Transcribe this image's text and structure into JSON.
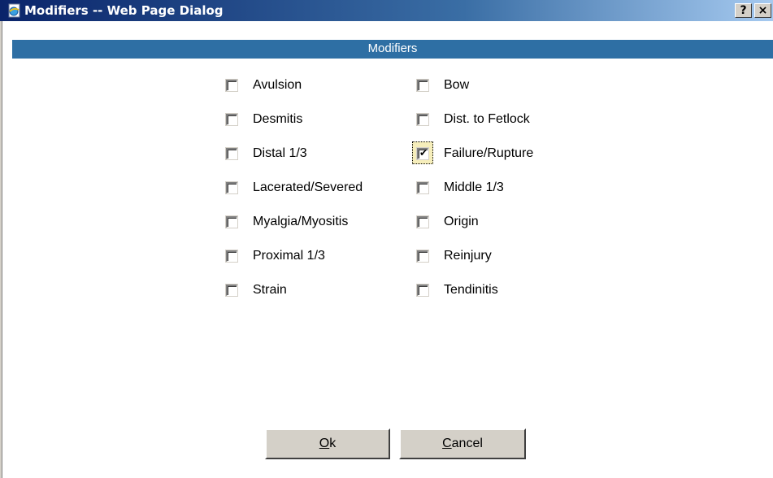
{
  "window": {
    "title": "Modifiers -- Web Page Dialog",
    "help_label": "?",
    "close_label": "×"
  },
  "header": {
    "title": "Modifiers"
  },
  "options": [
    {
      "label": "Avulsion",
      "checked": false
    },
    {
      "label": "Bow",
      "checked": false
    },
    {
      "label": "Desmitis",
      "checked": false
    },
    {
      "label": "Dist. to Fetlock",
      "checked": false
    },
    {
      "label": "Distal 1/3",
      "checked": false
    },
    {
      "label": "Failure/Rupture",
      "checked": true
    },
    {
      "label": "Lacerated/Severed",
      "checked": false
    },
    {
      "label": "Middle 1/3",
      "checked": false
    },
    {
      "label": "Myalgia/Myositis",
      "checked": false
    },
    {
      "label": "Origin",
      "checked": false
    },
    {
      "label": "Proximal 1/3",
      "checked": false
    },
    {
      "label": "Reinjury",
      "checked": false
    },
    {
      "label": "Strain",
      "checked": false
    },
    {
      "label": "Tendinitis",
      "checked": false
    }
  ],
  "buttons": {
    "ok": {
      "mnemonic": "O",
      "rest": "k"
    },
    "cancel": {
      "mnemonic": "C",
      "rest": "ancel"
    }
  },
  "colors": {
    "titlebar_start": "#0a246a",
    "header_band": "#2e6fa4",
    "focus_highlight": "#f6eebb",
    "face": "#d4d0c8"
  }
}
